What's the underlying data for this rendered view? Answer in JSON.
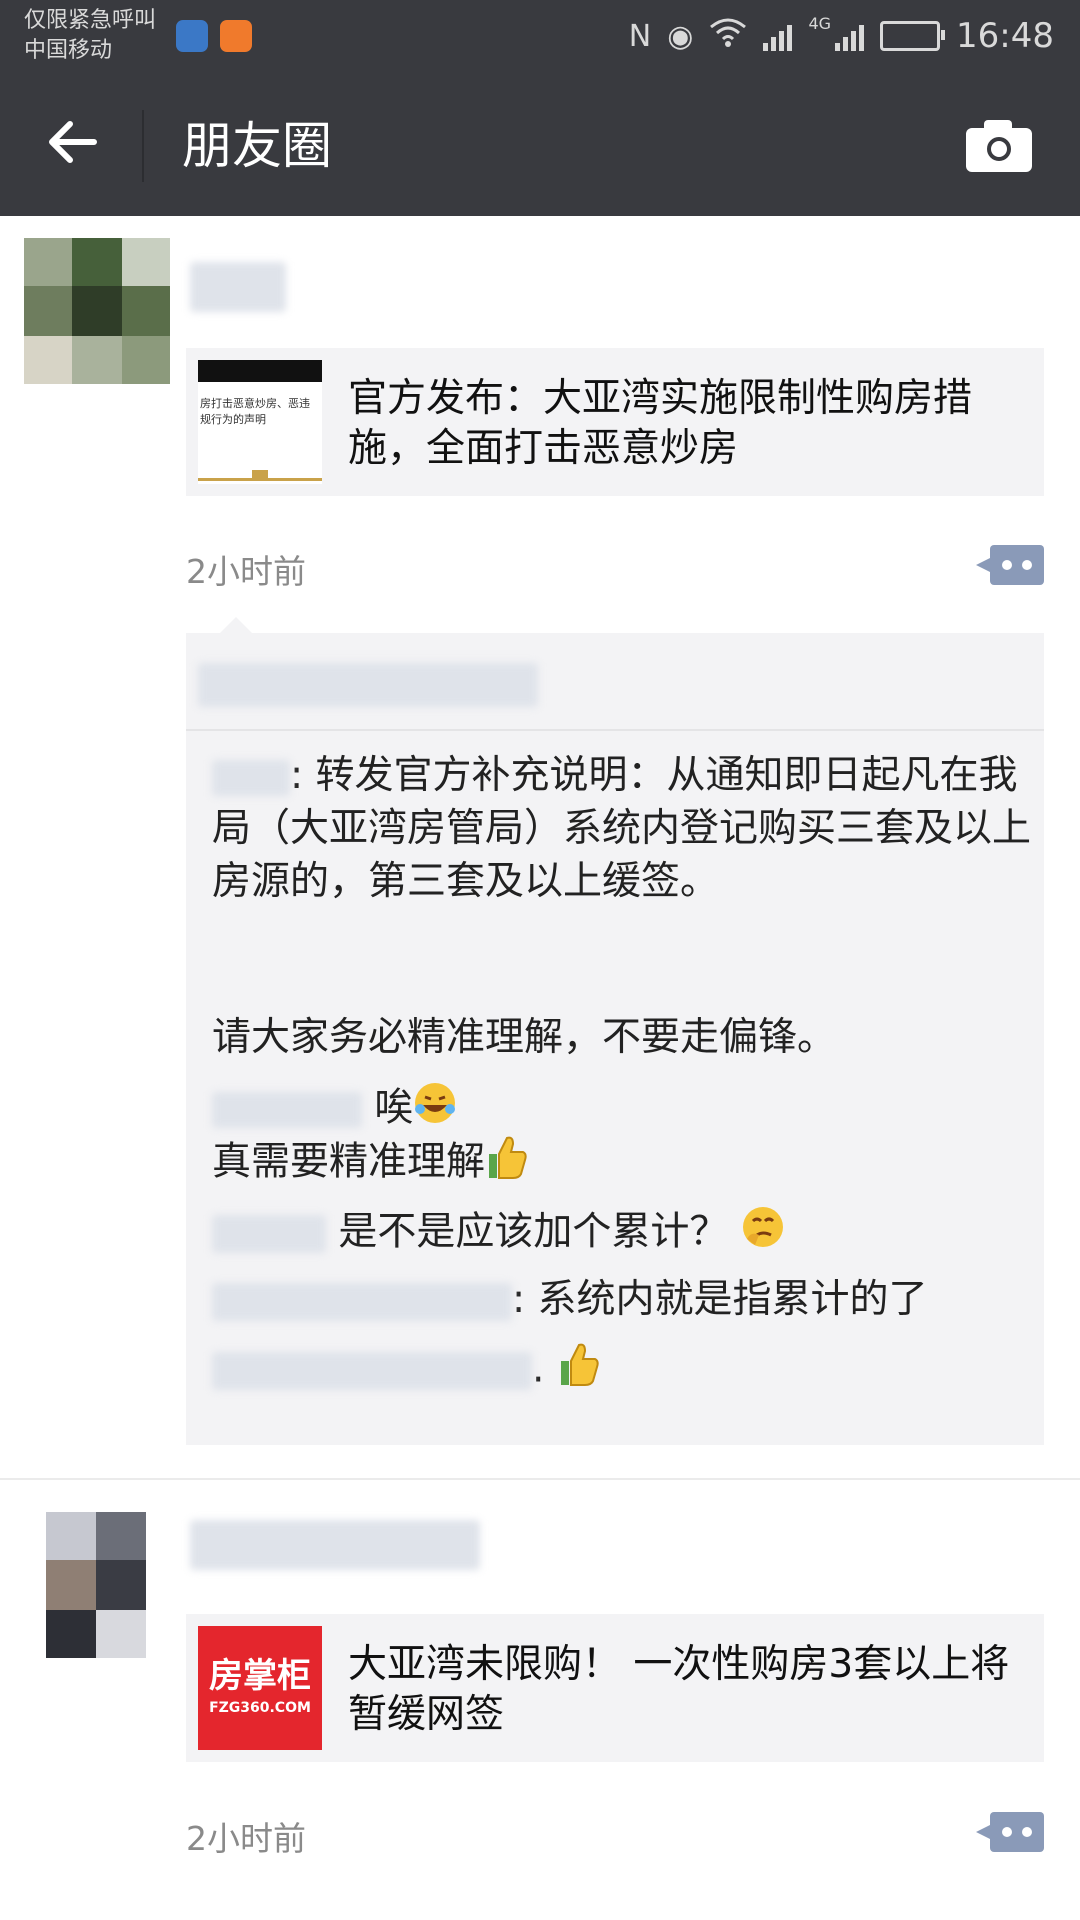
{
  "status_bar": {
    "carrier_line1": "仅限紧急呼叫",
    "carrier_line2": "中国移动",
    "network": "4G",
    "time": "16:48",
    "icons": [
      "nfc-icon",
      "eye-icon",
      "wifi-icon",
      "signal-icon",
      "battery-icon"
    ]
  },
  "nav": {
    "back_icon": "arrow-left-icon",
    "title": "朋友圈",
    "camera_icon": "camera-icon"
  },
  "posts": [
    {
      "link": {
        "title": "官方发布：大亚湾实施限制性购房措施，全面打击恶意炒房",
        "thumb_text": "房打击恶意炒房、恶违规行为的声明"
      },
      "time": "2小时前",
      "comments": [
        {
          "text": ": 转发官方补充说明：从通知即日起凡在我局（大亚湾房管局）系统内登记购买三套及以上房源的，第三套及以上缓签。"
        },
        {
          "text": "请大家务必精准理解，不要走偏锋。"
        },
        {
          "text": "唉"
        },
        {
          "text": "真需要精准理解"
        },
        {
          "text": "是不是应该加个累计？"
        },
        {
          "text": ": 系统内就是指累计的了"
        },
        {
          "text": "."
        }
      ]
    },
    {
      "link": {
        "title": "大亚湾未限购！ 一次性购房3套以上将暂缓网签",
        "thumb_logo": "房掌柜",
        "thumb_domain": "FZG360.COM"
      },
      "time": "2小时前"
    }
  ],
  "colors": {
    "bar_bg": "#393a3f",
    "card_bg": "#f3f3f5",
    "time_gray": "#8a8a8a",
    "more_btn": "#8a9ab8",
    "logo_red": "#e4262d"
  }
}
